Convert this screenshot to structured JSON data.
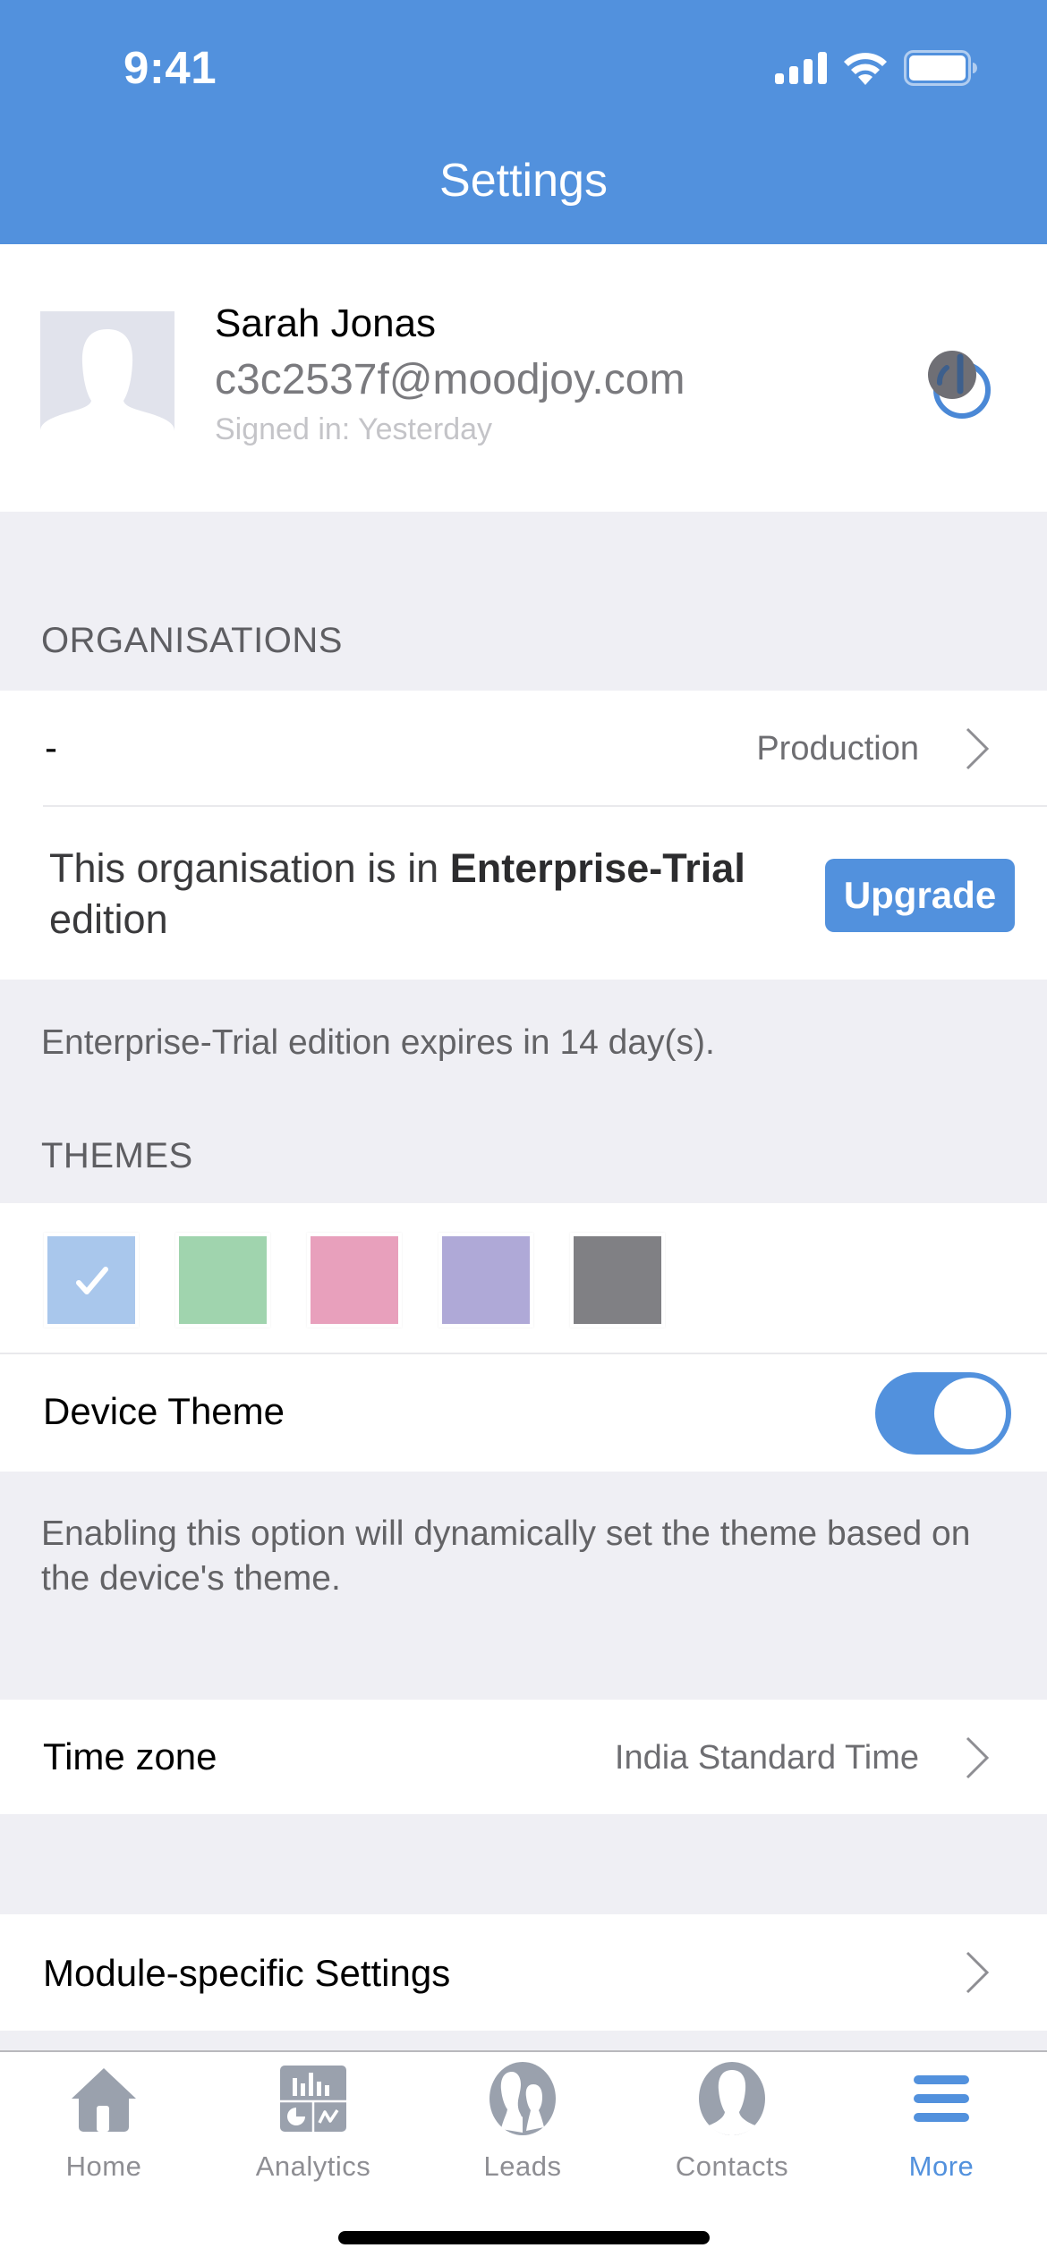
{
  "status_bar": {
    "time": "9:41",
    "icons": [
      "cellular-signal-icon",
      "wifi-icon",
      "battery-icon"
    ]
  },
  "nav": {
    "title": "Settings"
  },
  "colors": {
    "accent": "#5291DD",
    "background": "#EFEFF4",
    "icon_gray": "#9AA1AD"
  },
  "profile": {
    "name": "Sarah Jonas",
    "email": "c3c2537f@moodjoy.com",
    "signed_in": "Signed in: Yesterday",
    "action_icon": "power-icon"
  },
  "organisations": {
    "header": "ORGANISATIONS",
    "current_org": {
      "name": "-",
      "environment": "Production"
    },
    "edition": {
      "prefix": "This organisation is in ",
      "edition_name": "Enterprise-Trial",
      "suffix": " edition",
      "upgrade_label": "Upgrade"
    },
    "expiry_note": "Enterprise-Trial edition expires in 14 day(s)."
  },
  "themes": {
    "header": "THEMES",
    "swatches": [
      {
        "name": "blue",
        "color": "#A9C7EC",
        "selected": true
      },
      {
        "name": "green",
        "color": "#A0D4AE",
        "selected": false
      },
      {
        "name": "pink",
        "color": "#E8A0BC",
        "selected": false
      },
      {
        "name": "purple",
        "color": "#AFA9D7",
        "selected": false
      },
      {
        "name": "gray",
        "color": "#808084",
        "selected": false
      }
    ],
    "device_theme": {
      "label": "Device Theme",
      "enabled": true
    },
    "device_theme_note": "Enabling this option will dynamically set the theme based on the device's theme."
  },
  "time_zone": {
    "label": "Time zone",
    "value": "India Standard Time"
  },
  "module_settings": {
    "label": "Module-specific Settings"
  },
  "tab_bar": {
    "tabs": [
      {
        "label": "Home",
        "icon": "home-icon",
        "active": false
      },
      {
        "label": "Analytics",
        "icon": "analytics-icon",
        "active": false
      },
      {
        "label": "Leads",
        "icon": "leads-icon",
        "active": false
      },
      {
        "label": "Contacts",
        "icon": "contacts-icon",
        "active": false
      },
      {
        "label": "More",
        "icon": "menu-icon",
        "active": true
      }
    ]
  }
}
